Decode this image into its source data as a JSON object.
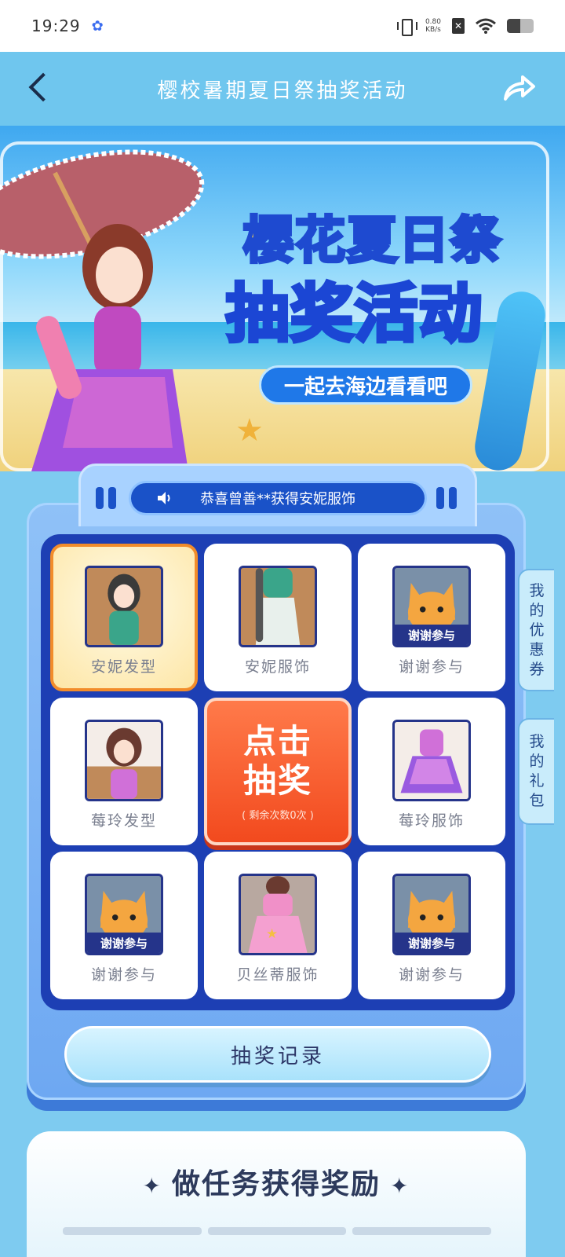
{
  "status_bar": {
    "time": "19:29",
    "speed_value": "0.80",
    "speed_unit": "KB/s",
    "battery_level": 0.5
  },
  "header": {
    "title": "樱校暑期夏日祭抽奖活动"
  },
  "banner": {
    "title_line1": "樱花夏日祭",
    "title_line2": "抽奖活动",
    "subtitle": "一起去海边看看吧"
  },
  "ticker": {
    "message": "恭喜曾善**获得安妮服饰"
  },
  "prizes": [
    {
      "label": "安妮发型",
      "icon": "annie-hairstyle-thumb"
    },
    {
      "label": "安妮服饰",
      "icon": "annie-outfit-thumb"
    },
    {
      "label": "谢谢参与",
      "icon": "cat-thumb",
      "tag": "谢谢参与"
    },
    {
      "label": "莓玲发型",
      "icon": "meiling-hairstyle-thumb"
    },
    {
      "label": "莓玲服饰",
      "icon": "meiling-outfit-thumb"
    },
    {
      "label": "谢谢参与",
      "icon": "cat-thumb",
      "tag": "谢谢参与"
    },
    {
      "label": "贝丝蒂服饰",
      "icon": "bessie-outfit-thumb"
    },
    {
      "label": "谢谢参与",
      "icon": "cat-thumb",
      "tag": "谢谢参与"
    }
  ],
  "draw_button": {
    "line1": "点击",
    "line2": "抽奖",
    "remaining": "( 剩余次数0次 )"
  },
  "record_button": "抽奖记录",
  "side_tabs": {
    "coupon": [
      "我",
      "的",
      "优",
      "惠",
      "券"
    ],
    "gift": [
      "我",
      "的",
      "礼",
      "包"
    ]
  },
  "tasks": {
    "title": "做任务获得奖励"
  },
  "colors": {
    "header_bg": "#6fc6ee",
    "grid_bg": "#1d3fb4",
    "draw_button": "#f24a1e",
    "active_border": "#f28c2a"
  }
}
